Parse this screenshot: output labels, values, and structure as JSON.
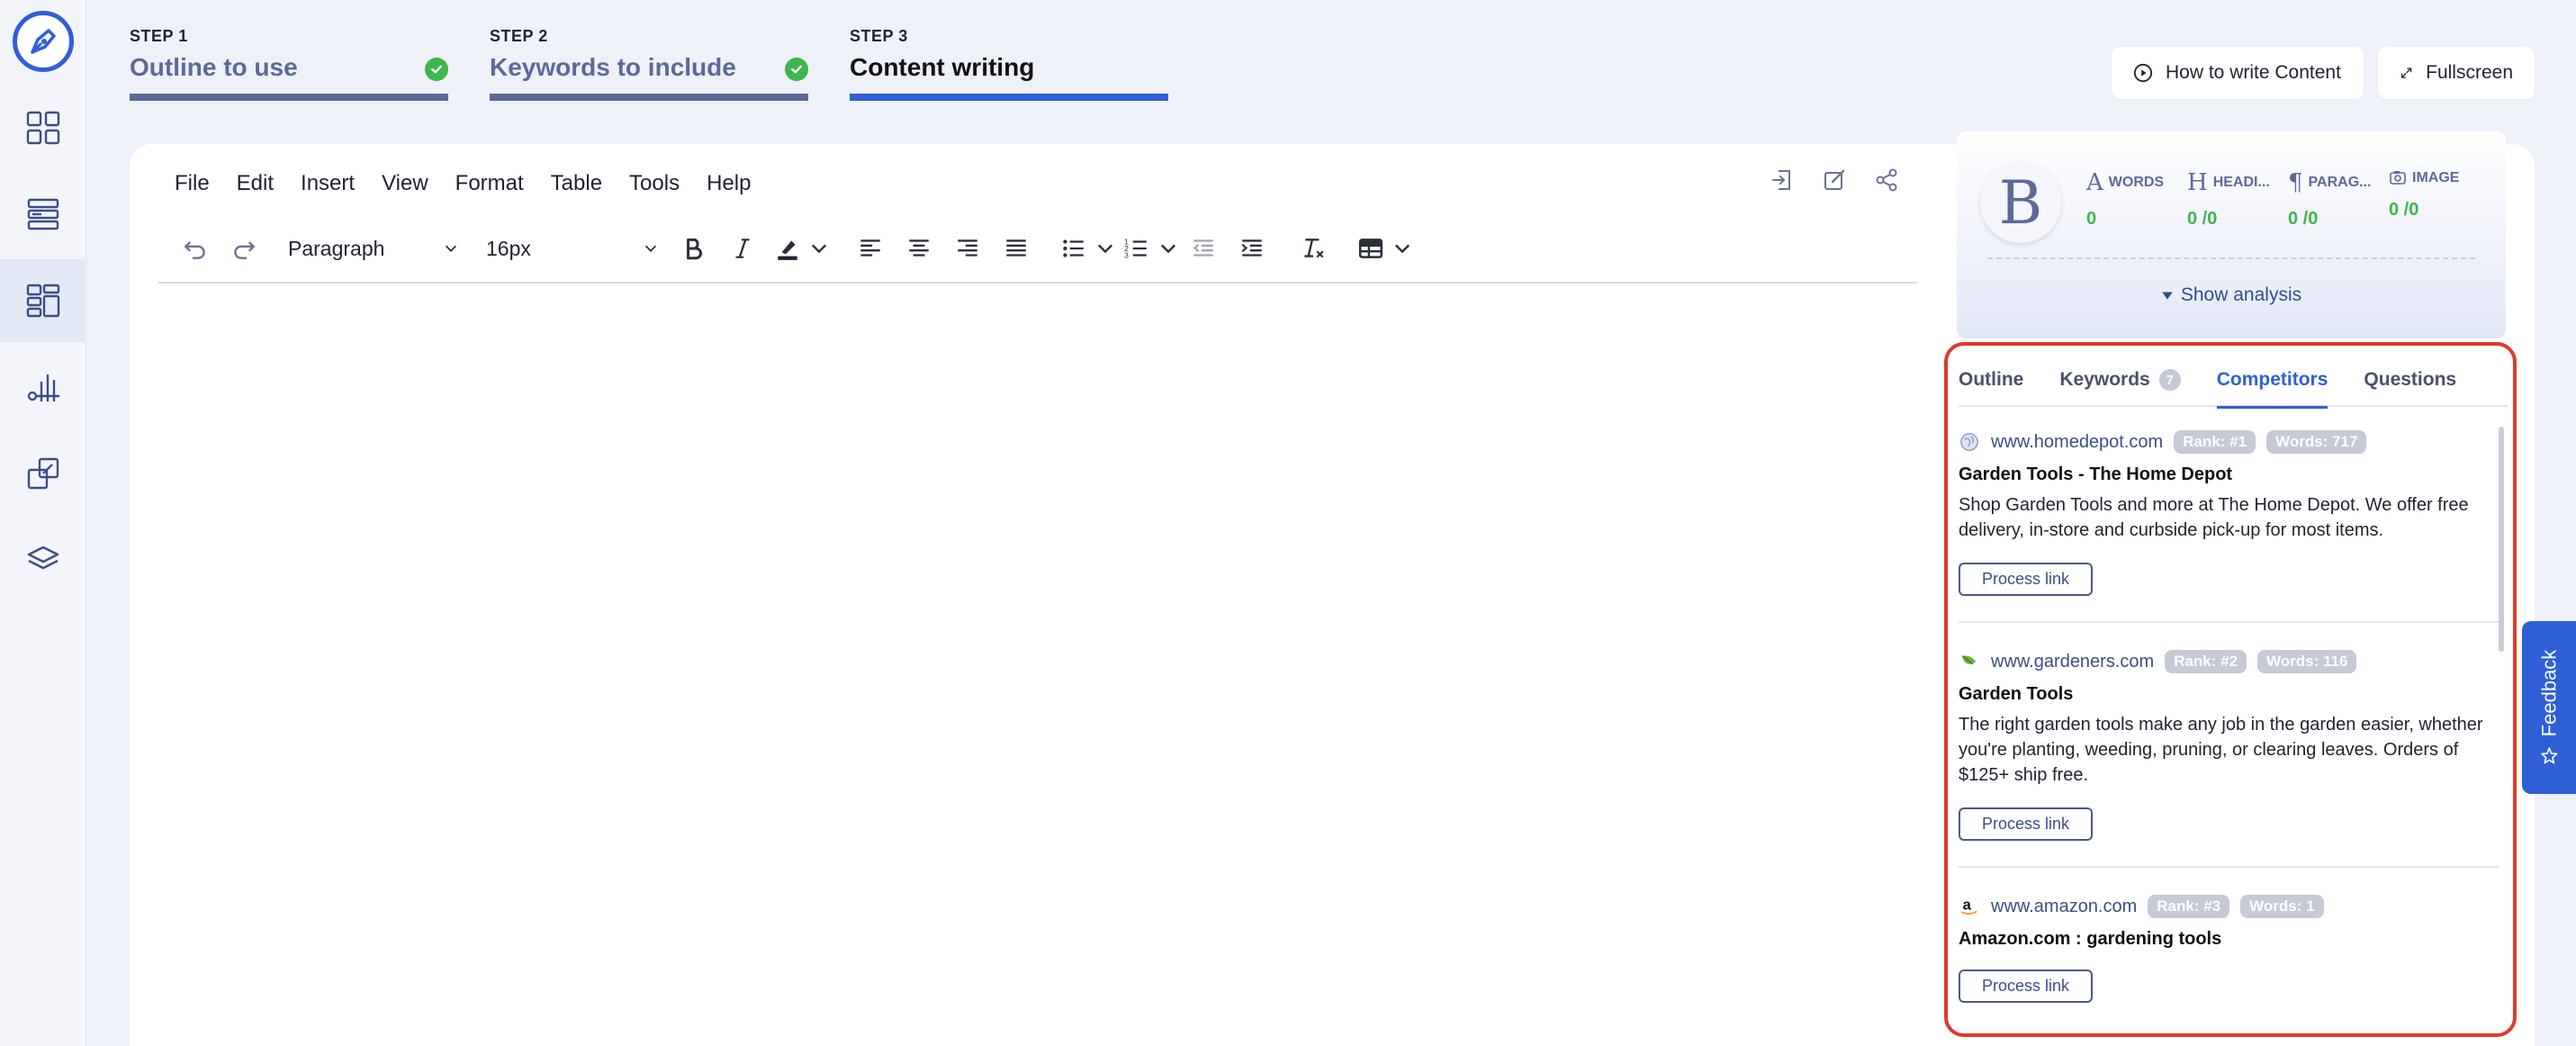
{
  "steps": [
    {
      "num": "STEP 1",
      "title": "Outline to use",
      "done": true
    },
    {
      "num": "STEP 2",
      "title": "Keywords to include",
      "done": true
    },
    {
      "num": "STEP 3",
      "title": "Content writing",
      "done": false
    }
  ],
  "top_buttons": {
    "how_to": "How to write Content",
    "fullscreen": "Fullscreen"
  },
  "menubar": [
    "File",
    "Edit",
    "Insert",
    "View",
    "Format",
    "Table",
    "Tools",
    "Help"
  ],
  "toolbar": {
    "block_format": "Paragraph",
    "font_size": "16px"
  },
  "analysis": {
    "avatar_letter": "B",
    "metrics": [
      {
        "glyph": "A",
        "label": "WORDS",
        "value": "0"
      },
      {
        "glyph": "H",
        "label": "HEADI...",
        "value": "0 /0"
      },
      {
        "glyph": "¶",
        "label": "PARAG...",
        "value": "0 /0"
      },
      {
        "glyph": "",
        "label": "IMAGE",
        "value": "0 /0"
      }
    ],
    "show_analysis": "Show analysis"
  },
  "tabs": [
    {
      "label": "Outline",
      "active": false
    },
    {
      "label": "Keywords",
      "count": "7",
      "active": false
    },
    {
      "label": "Competitors",
      "active": true
    },
    {
      "label": "Questions",
      "active": false
    }
  ],
  "competitors": [
    {
      "domain": "www.homedepot.com",
      "rank": "Rank: #1",
      "words": "Words: 717",
      "title": "Garden Tools - The Home Depot",
      "description": "Shop Garden Tools and more at The Home Depot. We offer free delivery, in-store and curbside pick-up for most items.",
      "button": "Process link",
      "favicon": "globe-icon"
    },
    {
      "domain": "www.gardeners.com",
      "rank": "Rank: #2",
      "words": "Words: 116",
      "title": "Garden Tools",
      "description": "The right garden tools make any job in the garden easier, whether you're planting, weeding, pruning, or clearing leaves. Orders of $125+ ship free.",
      "button": "Process link",
      "favicon": "leaf-icon"
    },
    {
      "domain": "www.amazon.com",
      "rank": "Rank: #3",
      "words": "Words: 1",
      "title": "Amazon.com : gardening tools",
      "description": "",
      "button": "Process link",
      "favicon": "amazon-icon"
    }
  ],
  "feedback": "Feedback",
  "colors": {
    "accent": "#2f5fd7",
    "success": "#3fb54d",
    "highlight_border": "#e03a2a"
  }
}
